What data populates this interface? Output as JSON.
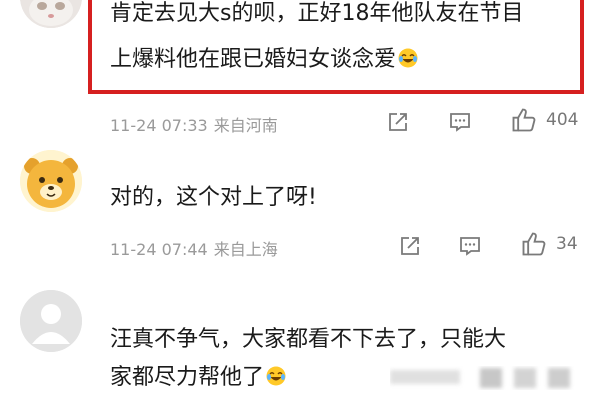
{
  "comments": [
    {
      "line1": "肯定去见大s的呗，正好18年他队友在节目",
      "line2": "上爆料他在跟已婚妇女谈念爱",
      "emoji": "laughing-tears-emoji",
      "time": "11-24 07:33",
      "location": "来自河南",
      "likes": "404"
    },
    {
      "line1": "对的，这个对上了呀!",
      "time": "11-24 07:44",
      "location": "来自上海",
      "likes": "34"
    },
    {
      "line1": "汪真不争气，大家都看不下去了，只能大",
      "line2": "家都尽力帮他了",
      "emoji": "laughing-tears-emoji"
    }
  ],
  "colors": {
    "highlight": "#d62020",
    "meta_text": "#9a9a9a",
    "icon_stroke": "#7a7a7a"
  }
}
